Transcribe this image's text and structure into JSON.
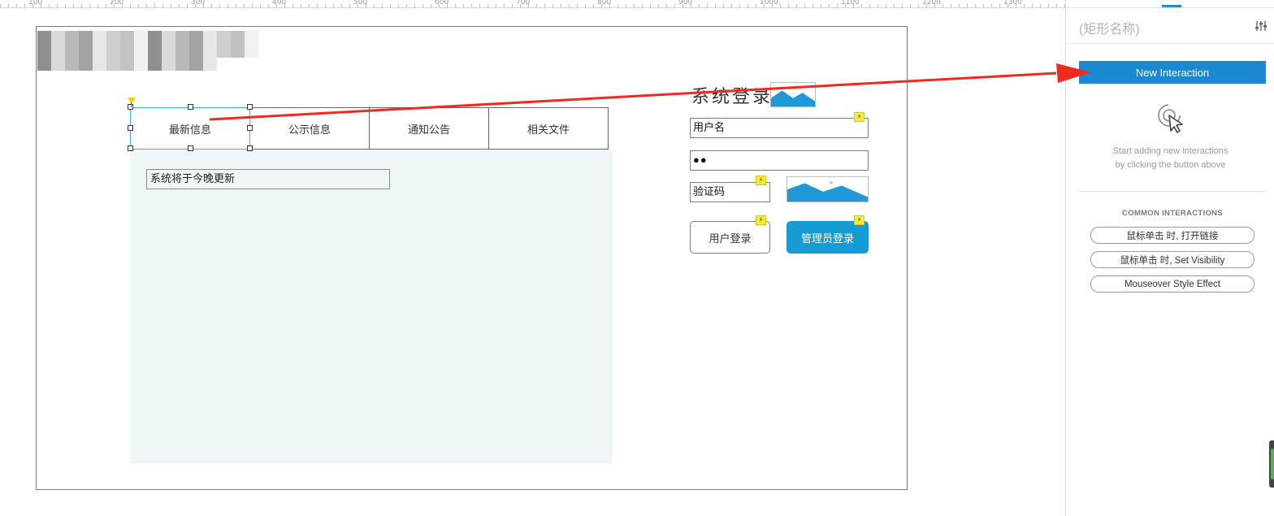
{
  "ruler": {
    "labels": [
      "100",
      "200",
      "300",
      "400",
      "500",
      "600",
      "700",
      "800",
      "900",
      "1000",
      "1100",
      "1200",
      "1300"
    ]
  },
  "canvas": {
    "tabs": [
      {
        "label": "最新信息"
      },
      {
        "label": "公示信息"
      },
      {
        "label": "通知公告"
      },
      {
        "label": "相关文件"
      }
    ],
    "news_text": "系统将于今晚更新",
    "login": {
      "title": "系统登录",
      "username_value": "用户名",
      "password_value": "●●",
      "captcha_value": "验证码",
      "user_login_label": "用户登录",
      "admin_login_label": "管理员登录"
    },
    "interaction_badge_icon": "lightning-icon",
    "colors": {
      "admin_button": "#169bd5",
      "selection": "#37b9c8",
      "content_panel": "#eef6f8",
      "arrow": "#f02a1e"
    }
  },
  "panel": {
    "shape_name": "(矩形名称)",
    "new_interaction_label": "New Interaction",
    "hint_line1": "Start adding new interactions",
    "hint_line2": "by clicking the button above",
    "common_title": "COMMON INTERACTIONS",
    "common_items": [
      {
        "label": "鼠标单击 时, 打开链接"
      },
      {
        "label": "鼠标单击 时, Set Visibility"
      },
      {
        "label": "Mouseover Style Effect"
      }
    ],
    "accent_color": "#1b88d2"
  }
}
